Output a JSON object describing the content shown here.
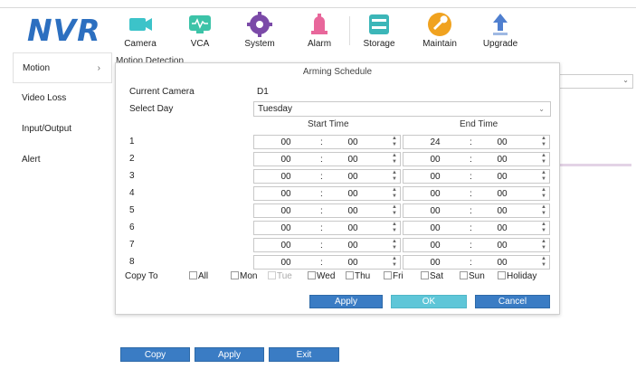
{
  "logo": "NVR",
  "nav": [
    {
      "label": "Camera",
      "icon": "camera-icon",
      "color": "#3cc3c9"
    },
    {
      "label": "VCA",
      "icon": "vca-icon",
      "color": "#3cc3a8"
    },
    {
      "label": "System",
      "icon": "gear-icon",
      "color": "#7b4aa8"
    },
    {
      "label": "Alarm",
      "icon": "alarm-icon",
      "color": "#e8679b"
    },
    {
      "label": "Storage",
      "icon": "storage-icon",
      "color": "#3cb6b8"
    },
    {
      "label": "Maintain",
      "icon": "wrench-icon",
      "color": "#f0a21f"
    },
    {
      "label": "Upgrade",
      "icon": "upgrade-icon",
      "color": "#4f7fcf"
    }
  ],
  "sidebar": [
    {
      "label": "Motion",
      "active": true
    },
    {
      "label": "Video Loss"
    },
    {
      "label": "Input/Output"
    },
    {
      "label": "Alert"
    }
  ],
  "background": {
    "section_title": "Motion Detection",
    "buttons": [
      "Copy",
      "Apply",
      "Exit"
    ]
  },
  "modal": {
    "title": "Arming Schedule",
    "current_camera_label": "Current Camera",
    "current_camera_value": "D1",
    "select_day_label": "Select Day",
    "select_day_value": "Tuesday",
    "start_time_header": "Start Time",
    "end_time_header": "End Time",
    "rows": [
      {
        "num": "1",
        "start_h": "00",
        "start_m": "00",
        "end_h": "24",
        "end_m": "00"
      },
      {
        "num": "2",
        "start_h": "00",
        "start_m": "00",
        "end_h": "00",
        "end_m": "00"
      },
      {
        "num": "3",
        "start_h": "00",
        "start_m": "00",
        "end_h": "00",
        "end_m": "00"
      },
      {
        "num": "4",
        "start_h": "00",
        "start_m": "00",
        "end_h": "00",
        "end_m": "00"
      },
      {
        "num": "5",
        "start_h": "00",
        "start_m": "00",
        "end_h": "00",
        "end_m": "00"
      },
      {
        "num": "6",
        "start_h": "00",
        "start_m": "00",
        "end_h": "00",
        "end_m": "00"
      },
      {
        "num": "7",
        "start_h": "00",
        "start_m": "00",
        "end_h": "00",
        "end_m": "00"
      },
      {
        "num": "8",
        "start_h": "00",
        "start_m": "00",
        "end_h": "00",
        "end_m": "00"
      }
    ],
    "copy_to_label": "Copy To",
    "copy_options": [
      {
        "label": "All",
        "disabled": false
      },
      {
        "label": "Mon",
        "disabled": false
      },
      {
        "label": "Tue",
        "disabled": true
      },
      {
        "label": "Wed",
        "disabled": false
      },
      {
        "label": "Thu",
        "disabled": false
      },
      {
        "label": "Fri",
        "disabled": false
      },
      {
        "label": "Sat",
        "disabled": false
      },
      {
        "label": "Sun",
        "disabled": false
      },
      {
        "label": "Holiday",
        "disabled": false
      }
    ],
    "apply_label": "Apply",
    "ok_label": "OK",
    "cancel_label": "Cancel",
    "colon": ":"
  },
  "colors": {
    "primary_button": "#3a7cc4",
    "ok_button": "#5ec6d8",
    "logo": "#2c6fc0"
  }
}
